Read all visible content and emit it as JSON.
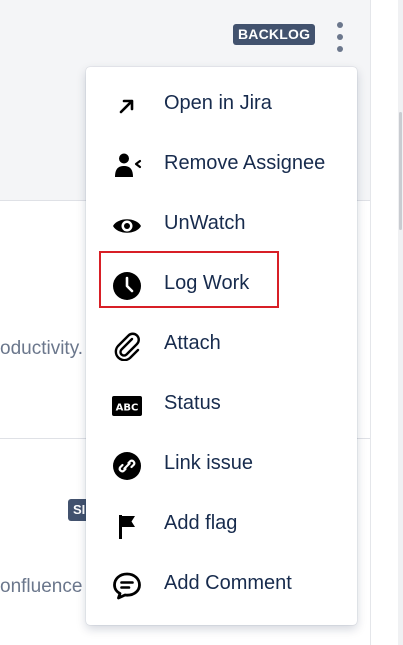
{
  "issue_card": {
    "status_badge": "BACKLOG",
    "text_fragment_1": "oductivity.",
    "badge_2": "SI",
    "text_fragment_2": "onfluence"
  },
  "context_menu": {
    "items": [
      {
        "label": "Open in Jira",
        "icon": "arrow-up-right-icon"
      },
      {
        "label": "Remove Assignee",
        "icon": "remove-user-icon"
      },
      {
        "label": "UnWatch",
        "icon": "eye-icon"
      },
      {
        "label": "Log Work",
        "icon": "clock-icon"
      },
      {
        "label": "Attach",
        "icon": "paperclip-icon"
      },
      {
        "label": "Status",
        "icon": "abc-icon"
      },
      {
        "label": "Link issue",
        "icon": "link-icon"
      },
      {
        "label": "Add flag",
        "icon": "flag-icon"
      },
      {
        "label": "Add Comment",
        "icon": "comment-icon"
      }
    ]
  },
  "colors": {
    "badge": "#42526e",
    "highlight": "#d81f26",
    "text": "#172b4d",
    "muted": "#6b778c"
  }
}
